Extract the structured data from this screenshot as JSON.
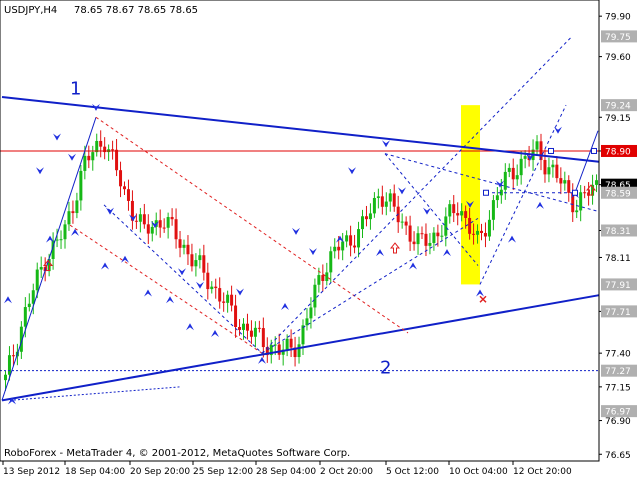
{
  "header": {
    "symbol_timeframe": "USDJPY,H4",
    "ohlc": "78.65 78.67 78.65 78.65"
  },
  "footer": {
    "copyright": "RoboForex - MetaTrader 4, © 2001-2012, MetaQuotes Software Corp."
  },
  "colors": {
    "up_candle": "#16b816",
    "down_candle": "#e01010",
    "trendline": "#1020c8",
    "fractal_arrow": "#2030e0",
    "price_line": "#e00000",
    "highlight": "#ffff00",
    "badge": "#b0b0b0",
    "current_price_badge": "#000000"
  },
  "chart_data": {
    "type": "candlestick",
    "ylim": [
      76.6,
      80.02
    ],
    "x_tick_labels": [
      "13 Sep 2012",
      "18 Sep 04:00",
      "20 Sep 20:00",
      "25 Sep 12:00",
      "28 Sep 04:00",
      "2 Oct 20:00",
      "5 Oct 12:00",
      "10 Oct 04:00",
      "12 Oct 20:00"
    ],
    "y_tick_labels": [
      "79.90",
      "79.60",
      "79.15",
      "78.90",
      "78.65",
      "78.31",
      "78.11",
      "77.71",
      "77.40",
      "77.15",
      "76.90",
      "76.65"
    ],
    "price_badges": [
      {
        "label": "79.75",
        "value": 79.75
      },
      {
        "label": "79.24",
        "value": 79.24
      },
      {
        "label": "78.90",
        "value": 78.9
      },
      {
        "label": "78.65",
        "value": 78.65
      },
      {
        "label": "78.59",
        "value": 78.59
      },
      {
        "label": "78.31",
        "value": 78.31
      },
      {
        "label": "77.91",
        "value": 77.91
      },
      {
        "label": "77.71",
        "value": 77.71
      },
      {
        "label": "77.27",
        "value": 77.27
      },
      {
        "label": "76.97",
        "value": 76.97
      }
    ],
    "current_price": 78.65,
    "horizontal_line_price": 78.9,
    "dotted_line_price": 77.27,
    "wave_labels": [
      "1",
      "2"
    ],
    "candles_approx_close": [
      77.2,
      77.7,
      78.1,
      78.3,
      78.8,
      79.0,
      78.6,
      78.3,
      78.4,
      78.2,
      78.0,
      77.8,
      77.6,
      77.5,
      77.4,
      77.5,
      78.0,
      78.2,
      78.3,
      78.6,
      78.4,
      78.2,
      78.3,
      78.5,
      78.2,
      78.6,
      78.8,
      78.9,
      78.7,
      78.5,
      78.65
    ]
  }
}
